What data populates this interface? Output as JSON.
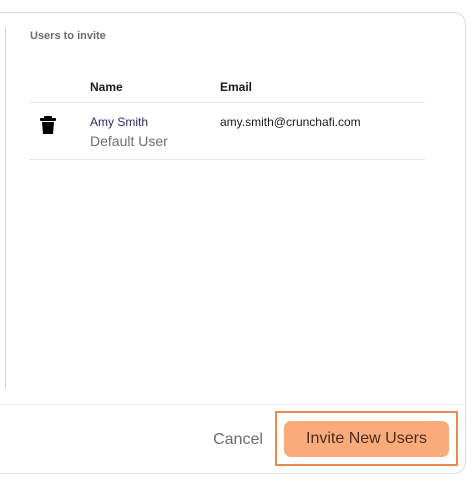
{
  "section": {
    "title": "Users to invite"
  },
  "table": {
    "headers": [
      "Name",
      "Email"
    ],
    "rows": [
      {
        "name": "Amy Smith",
        "role": "Default User",
        "email": "amy.smith@crunchafi.com",
        "delete_icon": "trash-icon"
      }
    ]
  },
  "footer": {
    "cancel_label": "Cancel",
    "invite_label": "Invite New Users"
  },
  "colors": {
    "accent": "#f9ab7a",
    "highlight_border": "#ec8a4e",
    "name_link": "#2b2b6b"
  }
}
